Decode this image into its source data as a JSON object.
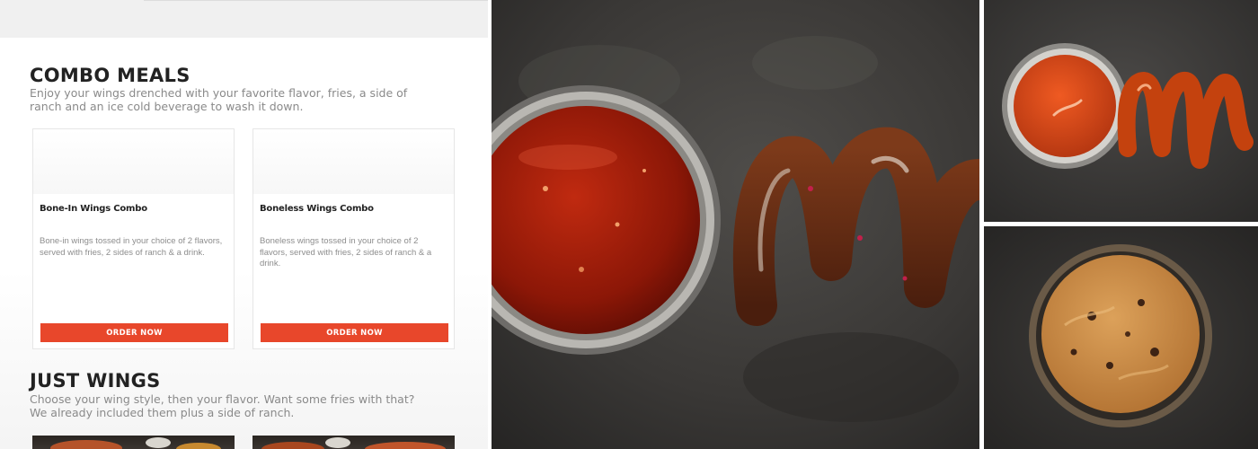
{
  "combo": {
    "title": "COMBO MEALS",
    "description": "Enjoy your wings drenched with your favorite flavor, fries, a side of ranch and an ice cold beverage to wash it down.",
    "cards": [
      {
        "name": "Bone-In Wings Combo",
        "description": "Bone-in wings tossed in your choice of 2 flavors, served with fries, 2 sides of ranch & a drink.",
        "button": "ORDER NOW"
      },
      {
        "name": "Boneless Wings Combo",
        "description": "Boneless wings tossed in your choice of 2 flavors, served with fries, 2 sides of ranch & a drink.",
        "button": "ORDER NOW"
      }
    ]
  },
  "wings": {
    "title": "JUST WINGS",
    "description": "Choose your wing style, then your flavor. Want some fries with that? We already included them plus a side of ranch."
  },
  "colors": {
    "accent": "#e8472b",
    "heading": "#222222",
    "body_text": "#8a8a8a"
  }
}
